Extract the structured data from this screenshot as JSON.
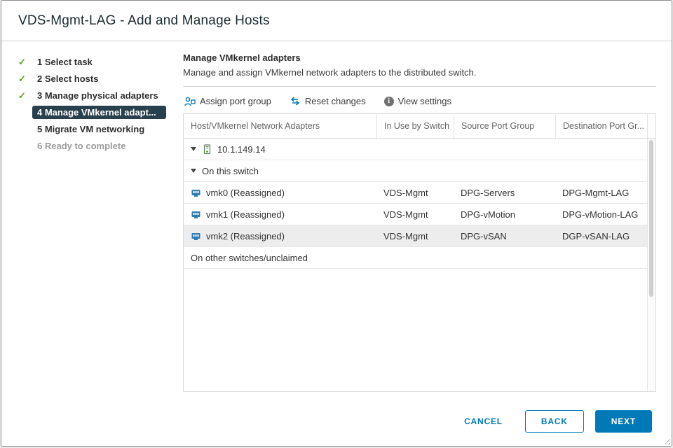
{
  "window": {
    "title": "VDS-Mgmt-LAG - Add and Manage Hosts"
  },
  "steps": [
    {
      "label": "1 Select task",
      "state": "done"
    },
    {
      "label": "2 Select hosts",
      "state": "done"
    },
    {
      "label": "3 Manage physical adapters",
      "state": "done"
    },
    {
      "label": "4 Manage VMkernel adapt...",
      "state": "active"
    },
    {
      "label": "5 Migrate VM networking",
      "state": "pending"
    },
    {
      "label": "6 Ready to complete",
      "state": "disabled"
    }
  ],
  "content": {
    "heading": "Manage VMkernel adapters",
    "subheading": "Manage and assign VMkernel network adapters to the distributed switch."
  },
  "toolbar": {
    "assign_label": "Assign port group",
    "reset_label": "Reset changes",
    "view_label": "View settings"
  },
  "table": {
    "columns": [
      "Host/VMkernel Network Adapters",
      "In Use by Switch",
      "Source Port Group",
      "Destination Port Gr..."
    ],
    "host": "10.1.149.14",
    "group_on_switch": "On this switch",
    "group_other": "On other switches/unclaimed",
    "rows": [
      {
        "adapter": "vmk0 (Reassigned)",
        "switch": "VDS-Mgmt",
        "source": "DPG-Servers",
        "dest": "DPG-Mgmt-LAG"
      },
      {
        "adapter": "vmk1 (Reassigned)",
        "switch": "VDS-Mgmt",
        "source": "DPG-vMotion",
        "dest": "DPG-vMotion-LAG"
      },
      {
        "adapter": "vmk2 (Reassigned)",
        "switch": "VDS-Mgmt",
        "source": "DPG-vSAN",
        "dest": "DGP-vSAN-LAG"
      }
    ]
  },
  "footer": {
    "cancel_label": "CANCEL",
    "back_label": "BACK",
    "next_label": "NEXT"
  },
  "colors": {
    "accent": "#0079b8",
    "active_step_bg": "#28404d",
    "check_green": "#5aa718",
    "selected_row": "#ededed"
  }
}
